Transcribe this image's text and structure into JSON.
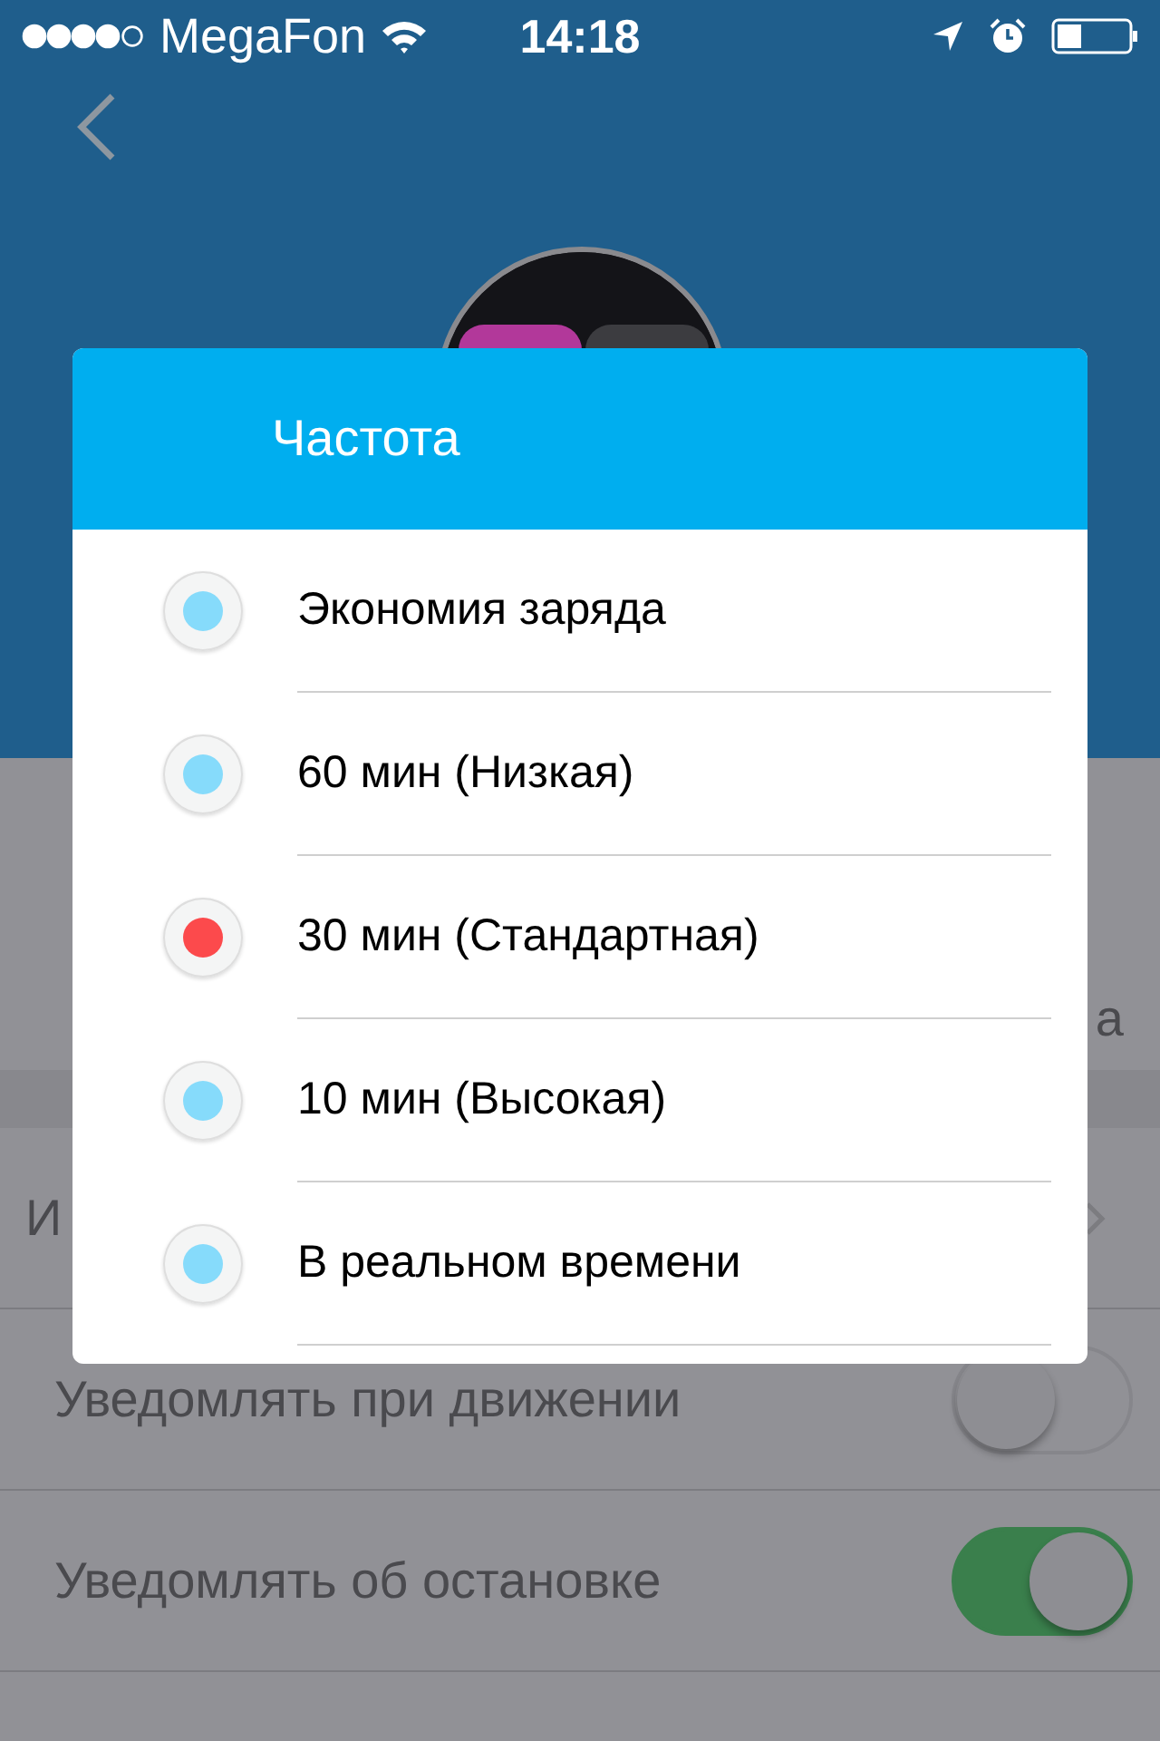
{
  "status_bar": {
    "carrier": "MegaFon",
    "time": "14:18"
  },
  "profile": {
    "trailing_text": "а"
  },
  "settings_rows": [
    {
      "label": "И",
      "kind": "link"
    },
    {
      "label": "Уведомлять при движении",
      "kind": "switch",
      "on": false
    },
    {
      "label": "Уведомлять об остановке",
      "kind": "switch",
      "on": true
    }
  ],
  "dialog": {
    "title": "Частота",
    "options": [
      {
        "label": "Экономия заряда",
        "selected": false
      },
      {
        "label": "60 мин (Низкая)",
        "selected": false
      },
      {
        "label": "30 мин (Стандартная)",
        "selected": true
      },
      {
        "label": "10 мин (Высокая)",
        "selected": false
      },
      {
        "label": "В реальном времени",
        "selected": false
      }
    ]
  }
}
